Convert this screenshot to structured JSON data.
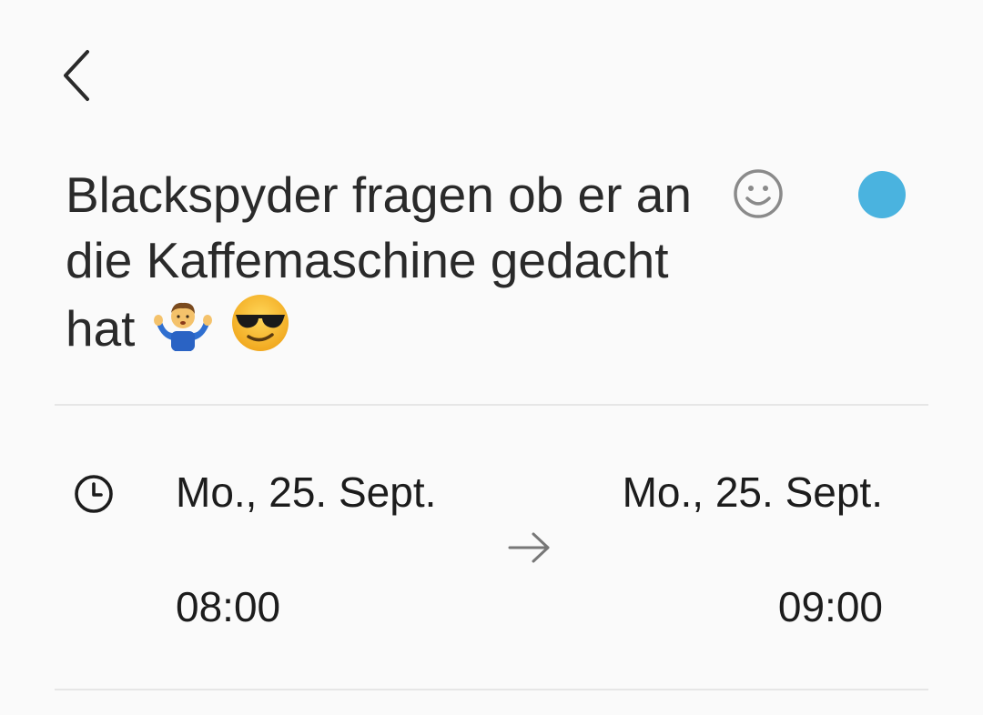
{
  "header": {
    "back_icon": "chevron-left-icon"
  },
  "event": {
    "title": "Blackspyder fragen ob er an die Kaffemaschine gedacht hat",
    "title_emojis": [
      "person-shrugging",
      "smiling-face-with-sunglasses"
    ],
    "emoji_picker_icon": "smiley-outline-icon",
    "color": "#4ab3df"
  },
  "time": {
    "icon": "clock-icon",
    "start_date": "Mo., 25. Sept.",
    "start_time": "08:00",
    "end_date": "Mo., 25. Sept.",
    "end_time": "09:00",
    "arrow_icon": "arrow-right-icon"
  }
}
